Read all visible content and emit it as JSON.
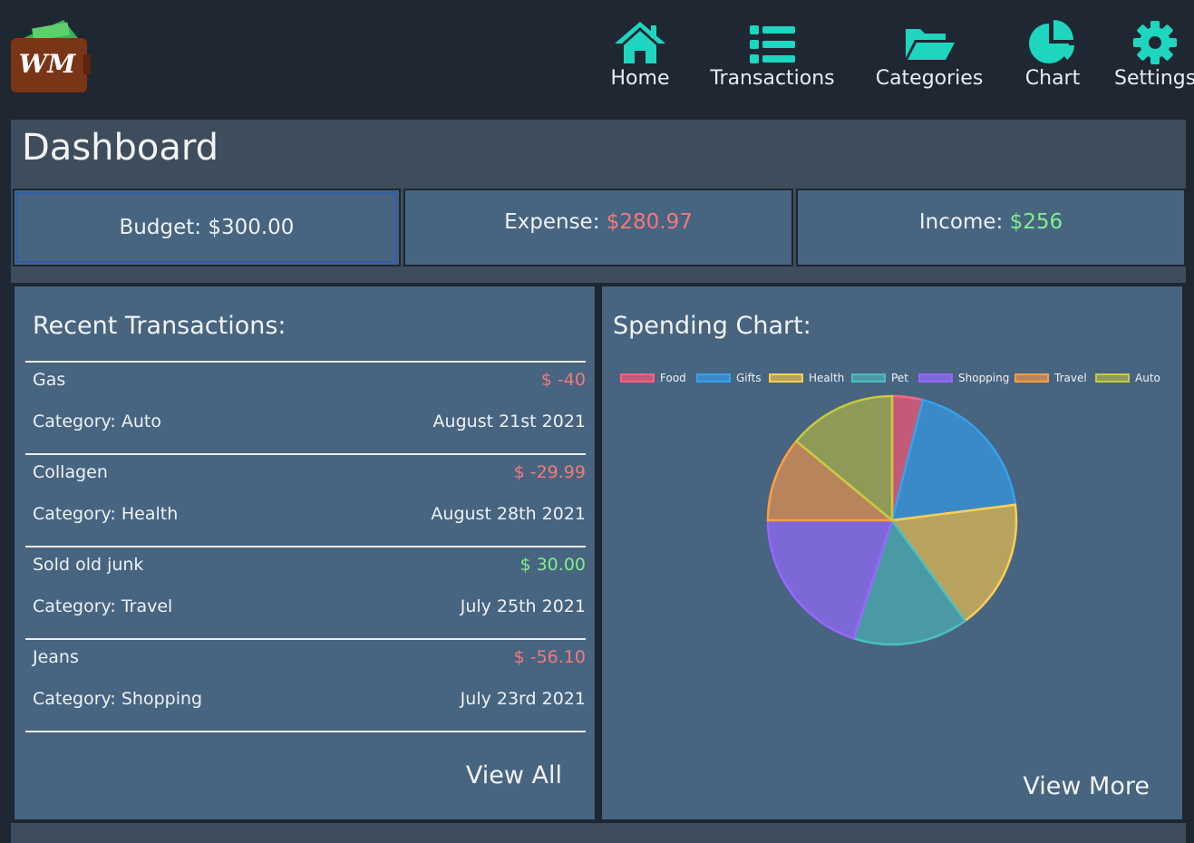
{
  "app": {
    "logo_text": "WM"
  },
  "nav": [
    {
      "label": "Home",
      "icon": "home-icon"
    },
    {
      "label": "Transactions",
      "icon": "list-icon"
    },
    {
      "label": "Categories",
      "icon": "folder-open-icon"
    },
    {
      "label": "Chart",
      "icon": "pie-chart-icon"
    },
    {
      "label": "Settings",
      "icon": "gear-icon"
    }
  ],
  "colors": {
    "accent": "#1ed6c0",
    "negative": "#f27a7a",
    "positive": "#7ef08a",
    "panel": "#476480"
  },
  "dashboard": {
    "title": "Dashboard",
    "budget_label": "Budget:",
    "budget_value": "$300.00",
    "expense_label": "Expense:",
    "expense_value": "$280.97",
    "income_label": "Income:",
    "income_value": "$256"
  },
  "recent": {
    "title": "Recent Transactions:",
    "transactions": [
      {
        "name": "Gas",
        "amount": "$ -40",
        "category": "Category: Auto",
        "date": "August 21st 2021",
        "sign": "neg"
      },
      {
        "name": "Collagen",
        "amount": "$ -29.99",
        "category": "Category: Health",
        "date": "August 28th 2021",
        "sign": "neg"
      },
      {
        "name": "Sold old junk",
        "amount": "$ 30.00",
        "category": "Category: Travel",
        "date": "July 25th 2021",
        "sign": "pos"
      },
      {
        "name": "Jeans",
        "amount": "$ -56.10",
        "category": "Category: Shopping",
        "date": "July 23rd 2021",
        "sign": "neg"
      }
    ],
    "view_all": "View All"
  },
  "spending": {
    "title": "Spending Chart:",
    "view_more": "View More"
  },
  "chart_data": {
    "type": "pie",
    "categories": [
      "Food",
      "Gifts",
      "Health",
      "Pet",
      "Shopping",
      "Travel",
      "Auto"
    ],
    "values": [
      4,
      19,
      17,
      15,
      20,
      11,
      14
    ],
    "colors": [
      "#c25a78",
      "#3a8ac8",
      "#b8a35e",
      "#4a9aa6",
      "#7d68d8",
      "#b8845c",
      "#8e9a58"
    ],
    "borders": [
      "#ff6384",
      "#36a2eb",
      "#ffce56",
      "#4bc0c0",
      "#9966ff",
      "#ff9f40",
      "#c9cb3f"
    ]
  }
}
